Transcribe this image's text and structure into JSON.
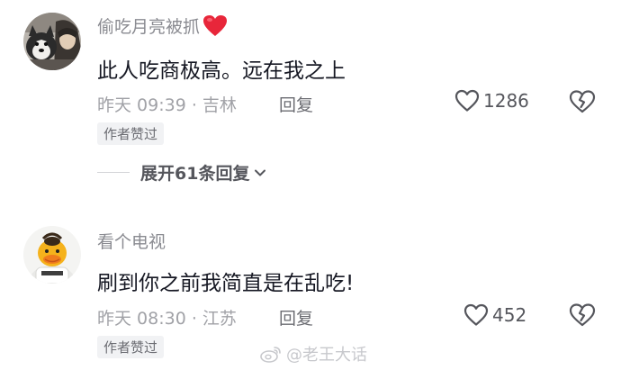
{
  "comments": [
    {
      "username": "偷吃月亮被抓",
      "emoji": "red-heart",
      "text": "此人吃商极高。远在我之上",
      "meta": "昨天 09:39 · 吉林",
      "reply_label": "回复",
      "likes": "1286",
      "badge": "作者赞过"
    },
    {
      "username": "看个电视",
      "text": "刷到你之前我简直是在乱吃!",
      "meta": "昨天 08:30 · 江苏",
      "reply_label": "回复",
      "likes": "452",
      "badge": "作者赞过"
    }
  ],
  "expand_replies": {
    "label": "展开61条回复"
  },
  "watermark": {
    "text": "@老王大话"
  },
  "colors": {
    "username": "#8a8b91",
    "body": "#161823",
    "meta": "#a1a2a7",
    "heart_emoji": "#e8263a"
  }
}
